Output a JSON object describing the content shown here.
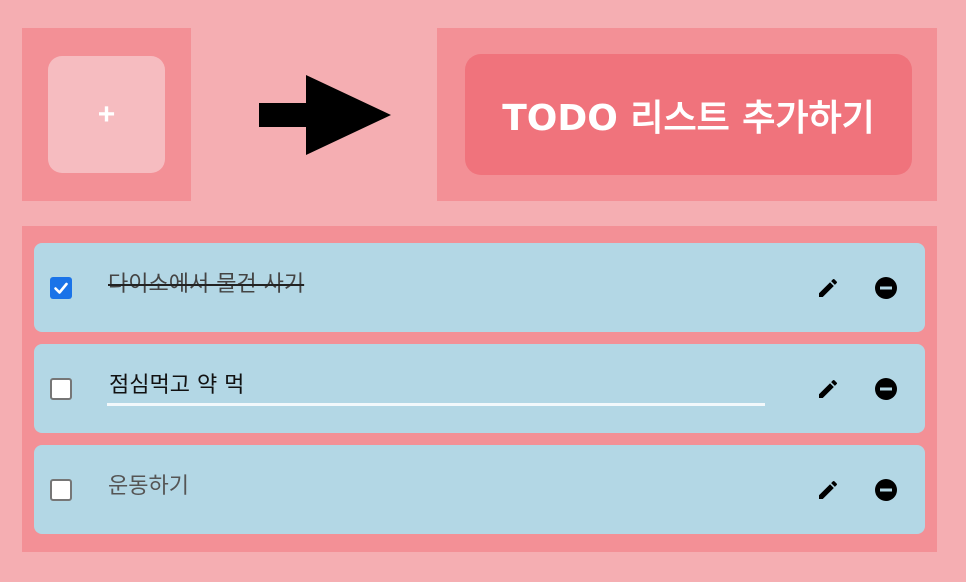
{
  "add_button": {
    "label": "+"
  },
  "add_list_button": {
    "label": "TODO 리스트 추가하기"
  },
  "todos": [
    {
      "text": "다이소에서 물건 사기",
      "checked": true,
      "editing": false
    },
    {
      "text": "점심먹고 약 먹",
      "checked": false,
      "editing": true
    },
    {
      "text": "운동하기",
      "checked": false,
      "editing": false
    }
  ],
  "icons": {
    "arrow": "arrow-right-icon",
    "edit": "pencil-icon",
    "delete": "minus-circle-icon",
    "check": "checkmark-icon"
  },
  "colors": {
    "background": "#f5aeb2",
    "panel": "#f39096",
    "accent": "#f0737c",
    "row": "#b3d7e5",
    "checkbox": "#1a73e8"
  }
}
